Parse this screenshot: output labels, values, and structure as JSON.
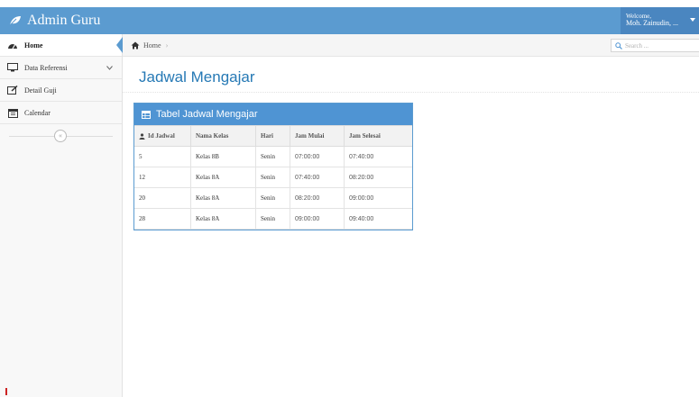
{
  "app": {
    "title": "Admin Guru"
  },
  "user": {
    "welcome": "Welcome,",
    "name": "Moh. Zainudin, ..."
  },
  "sidebar": {
    "items": [
      {
        "label": "Home",
        "icon": "dashboard-icon",
        "active": true
      },
      {
        "label": "Data Referensi",
        "icon": "desktop-icon",
        "has_submenu": true
      },
      {
        "label": "Detail Guji",
        "icon": "edit-icon"
      },
      {
        "label": "Calendar",
        "icon": "calendar-icon"
      }
    ]
  },
  "breadcrumb": {
    "home": "Home"
  },
  "search": {
    "placeholder": "Search ..."
  },
  "page": {
    "title": "Jadwal Mengajar"
  },
  "widget": {
    "title": "Tabel Jadwal Mengajar",
    "columns": [
      "Id Jadwal",
      "Nama Kelas",
      "Hari",
      "Jam Mulai",
      "Jam Selesai"
    ],
    "rows": [
      [
        "5",
        "Kelas 8B",
        "Senin",
        "07:00:00",
        "07:40:00"
      ],
      [
        "12",
        "Kelas 8A",
        "Senin",
        "07:40:00",
        "08:20:00"
      ],
      [
        "20",
        "Kelas 8A",
        "Senin",
        "08:20:00",
        "09:00:00"
      ],
      [
        "28",
        "Kelas 8A",
        "Senin",
        "09:00:00",
        "09:40:00"
      ]
    ]
  },
  "colors": {
    "navbar": "#5b9bd0",
    "widget_header": "#4f94d3",
    "title": "#2679b5"
  }
}
